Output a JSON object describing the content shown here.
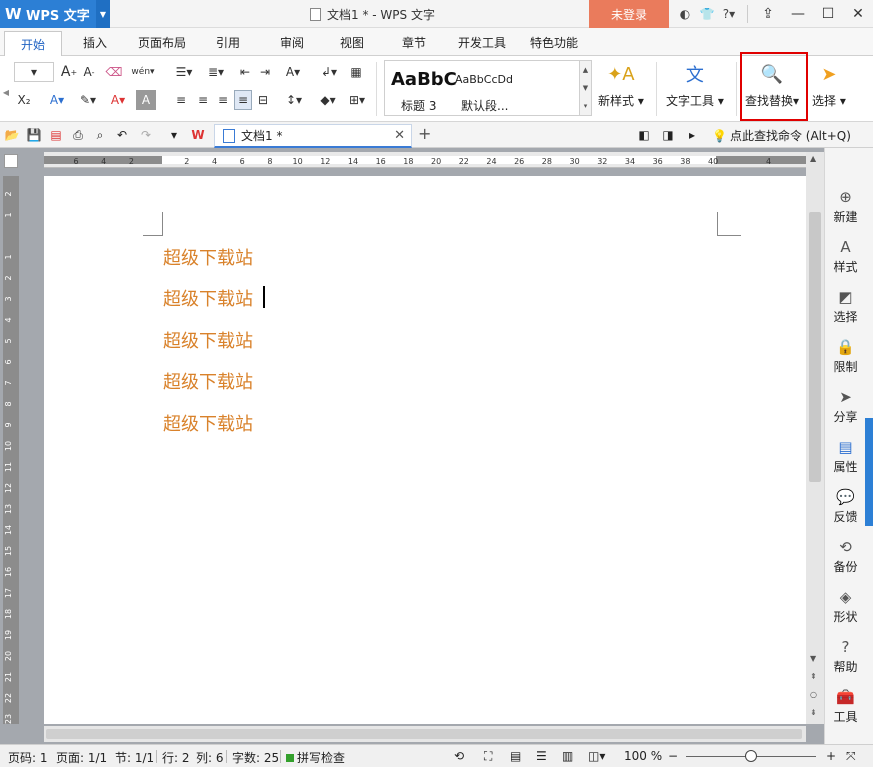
{
  "titlebar": {
    "app_name": "WPS 文字",
    "doc_title": "文档1 * - WPS 文字",
    "login_label": "未登录",
    "help_label": "?"
  },
  "menu": {
    "tabs": [
      {
        "label": "开始",
        "active": true
      },
      {
        "label": "插入"
      },
      {
        "label": "页面布局"
      },
      {
        "label": "引用"
      },
      {
        "label": "审阅"
      },
      {
        "label": "视图"
      },
      {
        "label": "章节"
      },
      {
        "label": "开发工具"
      },
      {
        "label": "特色功能"
      }
    ]
  },
  "ribbon": {
    "style_preview_big": "AaBbC",
    "style_preview_small": "AaBbCcDd",
    "style_label_1": "标题 3",
    "style_label_2": "默认段...",
    "new_style_label": "新样式",
    "text_tools_label": "文字工具",
    "find_replace_label": "查找替换",
    "select_label": "选择",
    "font_grow": "A",
    "font_shrink": "A",
    "wen_label": "wén"
  },
  "doc_tab": {
    "name": "文档1 *",
    "hint": "点此查找命令 (Alt+Q)"
  },
  "ruler": {
    "h_ticks": [
      "6",
      "4",
      "2",
      "",
      "2",
      "4",
      "6",
      "8",
      "10",
      "12",
      "14",
      "16",
      "18",
      "20",
      "22",
      "24",
      "26",
      "28",
      "30",
      "32",
      "34",
      "36",
      "38",
      "40",
      "",
      "4"
    ],
    "v_ticks": [
      "2",
      "1",
      "",
      "1",
      "2",
      "3",
      "4",
      "5",
      "6",
      "7",
      "8",
      "9",
      "10",
      "11",
      "12",
      "13",
      "14",
      "15",
      "16",
      "17",
      "18",
      "19",
      "20",
      "21",
      "22",
      "23"
    ]
  },
  "document": {
    "lines": [
      "超级下载站",
      "超级下载站",
      "超级下载站",
      "超级下载站",
      "超级下载站"
    ]
  },
  "sidebar": {
    "items": [
      {
        "label": "新建",
        "icon": "new-icon"
      },
      {
        "label": "样式",
        "icon": "style-icon"
      },
      {
        "label": "选择",
        "icon": "select-icon"
      },
      {
        "label": "限制",
        "icon": "restrict-icon"
      },
      {
        "label": "分享",
        "icon": "share-icon"
      },
      {
        "label": "属性",
        "icon": "properties-icon"
      },
      {
        "label": "反馈",
        "icon": "feedback-icon"
      },
      {
        "label": "备份",
        "icon": "backup-icon"
      },
      {
        "label": "形状",
        "icon": "shape-icon"
      },
      {
        "label": "帮助",
        "icon": "help-icon"
      },
      {
        "label": "工具",
        "icon": "tools-icon"
      }
    ]
  },
  "status": {
    "page_num": "页码: 1",
    "pages": "页面: 1/1",
    "section": "节: 1/1",
    "row": "行: 2",
    "col": "列: 6",
    "word_count": "字数: 25",
    "spellcheck": "拼写检查",
    "zoom": "100 %",
    "zoom_fraction": 0.5
  },
  "colors": {
    "accent": "#2c7fd5",
    "login": "#ea7b5c",
    "doc_text": "#d9822b",
    "highlight": "#e00000"
  }
}
